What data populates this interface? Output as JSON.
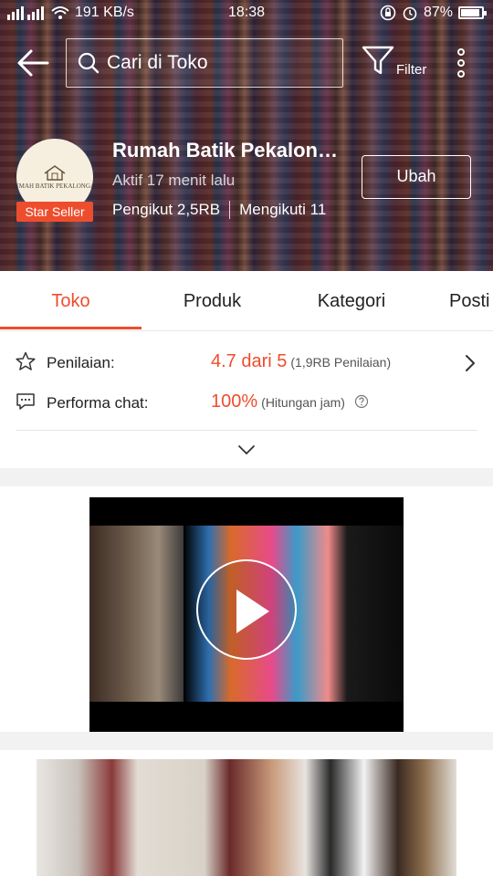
{
  "status_bar": {
    "network": "3G 4G",
    "speed": "191 KB/s",
    "time": "18:38",
    "battery": "87%"
  },
  "top_bar": {
    "search_placeholder": "Cari di Toko",
    "filter_label": "Filter"
  },
  "shop": {
    "logo_text": "RUMAH BATIK PEKALONGAN",
    "badge": "Star Seller",
    "name": "Rumah Batik Pekalon…",
    "active_status": "Aktif 17 menit lalu",
    "followers": "Pengikut 2,5RB",
    "following": "Mengikuti 11",
    "edit_label": "Ubah"
  },
  "tabs": [
    {
      "label": "Toko",
      "active": true
    },
    {
      "label": "Produk",
      "active": false
    },
    {
      "label": "Kategori",
      "active": false
    },
    {
      "label": "Posti",
      "active": false
    }
  ],
  "stats": {
    "rating_label": "Penilaian:",
    "rating_value": "4.7 dari 5",
    "rating_sub": "(1,9RB Penilaian)",
    "chat_label": "Performa chat:",
    "chat_value": "100%",
    "chat_sub": "(Hitungan jam)"
  },
  "colors": {
    "accent": "#ee4d2d",
    "text": "#222222",
    "divider": "#e6e6e6",
    "section_gap": "#f2f2f2"
  },
  "icons": [
    "back-arrow-icon",
    "search-icon",
    "filter-icon",
    "more-vertical-icon",
    "star-icon",
    "chat-icon",
    "help-icon",
    "chevron-right-icon",
    "chevron-down-icon",
    "play-icon",
    "wifi-icon",
    "alarm-icon"
  ]
}
